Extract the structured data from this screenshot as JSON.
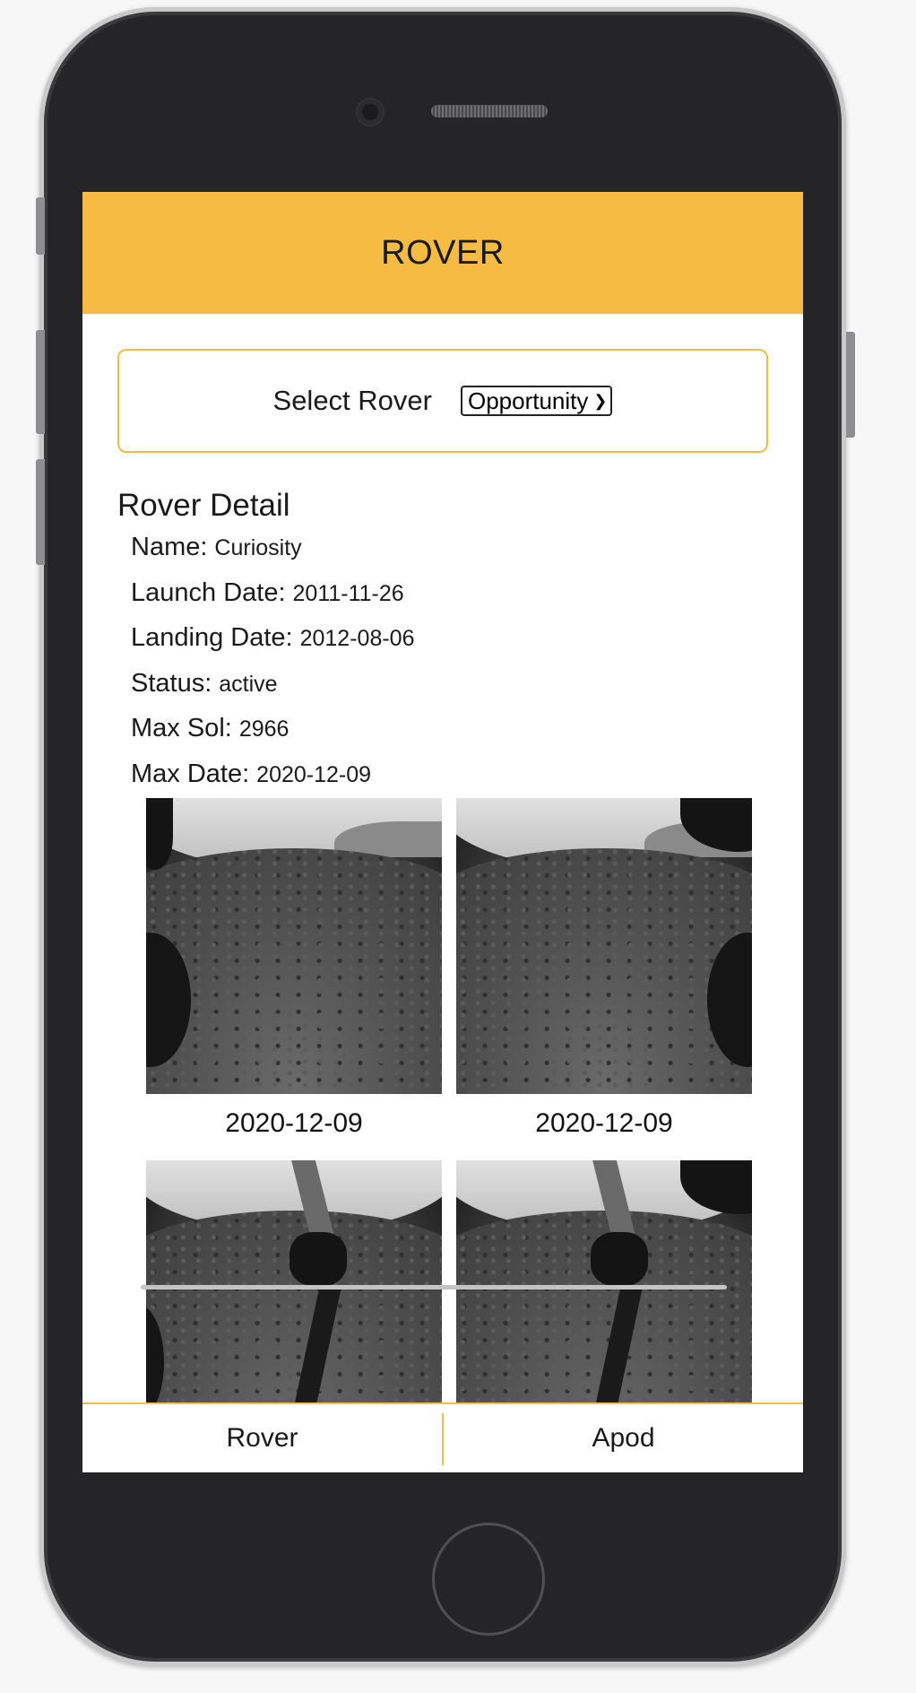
{
  "header": {
    "title": "ROVER"
  },
  "rover_select": {
    "label": "Select Rover",
    "selected": "Opportunity"
  },
  "detail": {
    "title": "Rover Detail",
    "rows": [
      {
        "key": "Name:",
        "value": "Curiosity"
      },
      {
        "key": "Launch Date:",
        "value": "2011-11-26"
      },
      {
        "key": "Landing Date:",
        "value": "2012-08-06"
      },
      {
        "key": "Status:",
        "value": "active"
      },
      {
        "key": "Max Sol:",
        "value": "2966"
      },
      {
        "key": "Max Date:",
        "value": "2020-12-09"
      }
    ]
  },
  "photos": [
    {
      "date": "2020-12-09"
    },
    {
      "date": "2020-12-09"
    },
    {
      "date": ""
    },
    {
      "date": ""
    }
  ],
  "tabbar": {
    "rover": "Rover",
    "apod": "Apod"
  },
  "colors": {
    "accent": "#f5bb42",
    "phone_body": "#252527"
  }
}
